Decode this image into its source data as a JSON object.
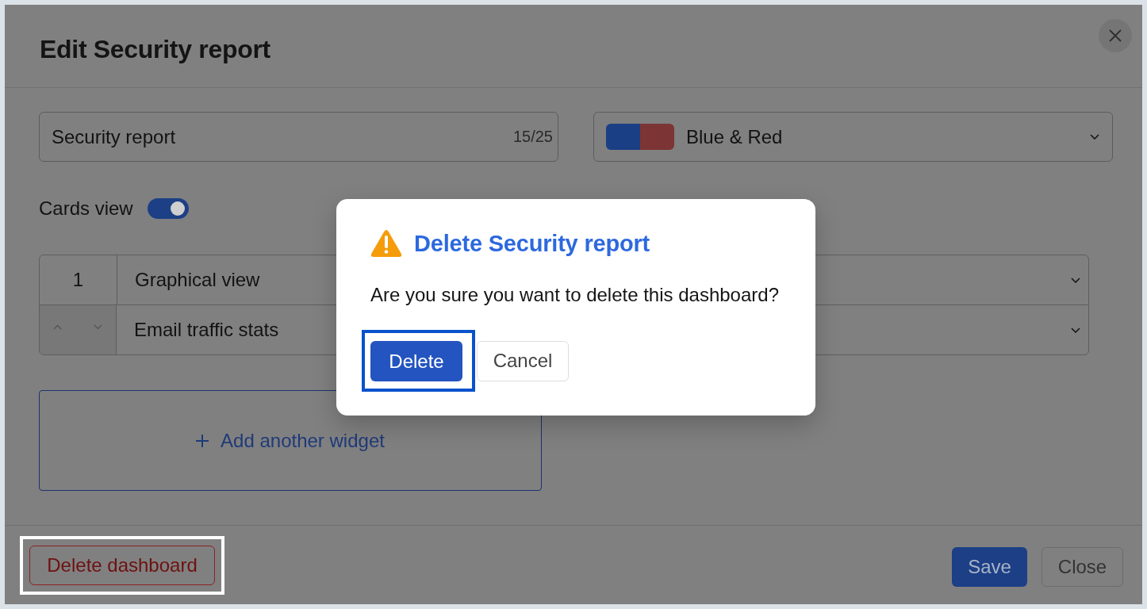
{
  "edit_dialog": {
    "title": "Edit Security report",
    "name_field": {
      "value": "Security report",
      "counter": "15/25"
    },
    "color_select": {
      "value": "Blue & Red",
      "swatch": [
        {
          "color": "#1b3f84"
        },
        {
          "color": "#7d3434"
        }
      ]
    },
    "cards_view": {
      "label": "Cards view",
      "on": true
    },
    "widgets": [
      {
        "order": "1",
        "name": "Graphical view",
        "hovered": false
      },
      {
        "name": "Email traffic stats",
        "hovered": true
      }
    ],
    "add_widget": {
      "label": "Add another widget"
    },
    "footer": {
      "delete_button": {
        "label": "Delete dashboard",
        "highlighted": true
      },
      "buttons": [
        {
          "label": "Save",
          "kind": "primary"
        },
        {
          "label": "Close",
          "kind": "secondary"
        }
      ]
    }
  },
  "confirm_dialog": {
    "title": "Delete Security report",
    "message": "Are you sure you want to delete this dashboard?",
    "buttons": [
      {
        "label": "Delete",
        "kind": "primary",
        "highlighted": true
      },
      {
        "label": "Cancel",
        "kind": "secondary",
        "highlighted": false
      }
    ]
  }
}
